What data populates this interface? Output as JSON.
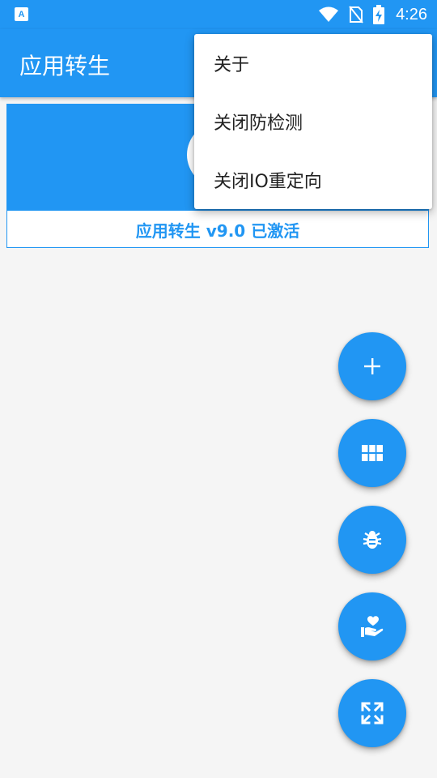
{
  "status_bar": {
    "app_icon_letter": "A",
    "time": "4:26"
  },
  "app_bar": {
    "title": "应用转生"
  },
  "card": {
    "status_text": "应用转生 v9.0 已激活"
  },
  "overflow_menu": {
    "items": [
      {
        "label": "关于"
      },
      {
        "label": "关闭防检测"
      },
      {
        "label": "关闭IO重定向"
      }
    ]
  },
  "fabs": [
    {
      "icon": "add-icon"
    },
    {
      "icon": "grid-icon"
    },
    {
      "icon": "bug-icon"
    },
    {
      "icon": "hand-heart-icon"
    },
    {
      "icon": "expand-icon"
    }
  ],
  "colors": {
    "primary": "#2196f3",
    "background": "#f5f5f5",
    "menu_text": "#212121"
  }
}
